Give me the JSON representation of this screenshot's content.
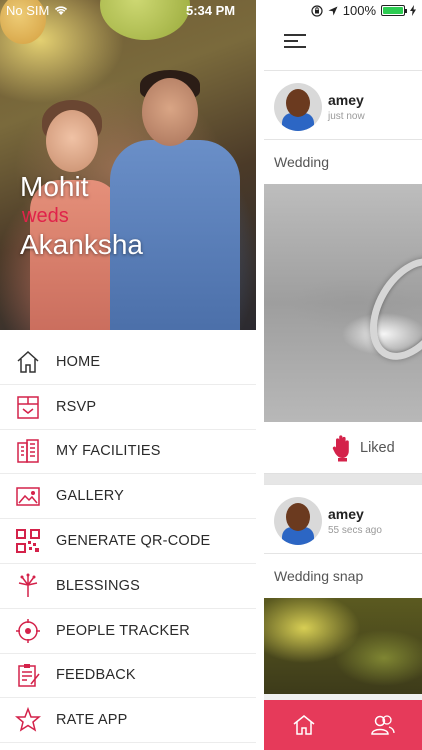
{
  "status_bar": {
    "carrier": "No SIM",
    "time": "5:34 PM",
    "battery": "100%"
  },
  "hero": {
    "groom": "Mohit",
    "connector": "weds",
    "bride": "Akanksha"
  },
  "menu": {
    "items": [
      {
        "label": "HOME",
        "icon": "home-icon"
      },
      {
        "label": "RSVP",
        "icon": "invitation-icon"
      },
      {
        "label": "MY FACILITIES",
        "icon": "building-icon"
      },
      {
        "label": "GALLERY",
        "icon": "image-icon"
      },
      {
        "label": "GENERATE QR-CODE",
        "icon": "qr-code-icon"
      },
      {
        "label": "BLESSINGS",
        "icon": "fireworks-icon"
      },
      {
        "label": "PEOPLE TRACKER",
        "icon": "target-icon"
      },
      {
        "label": "FEEDBACK",
        "icon": "clipboard-icon"
      },
      {
        "label": "RATE APP",
        "icon": "star-icon"
      }
    ]
  },
  "feed": {
    "posts": [
      {
        "author": "amey",
        "time": "just now",
        "caption": "Wedding",
        "like_label": "Liked"
      },
      {
        "author": "amey",
        "time": "55 secs ago",
        "caption": "Wedding snap"
      }
    ]
  },
  "colors": {
    "accent": "#e63a5a",
    "weds": "#e0234a",
    "icon": "#d4224a"
  }
}
